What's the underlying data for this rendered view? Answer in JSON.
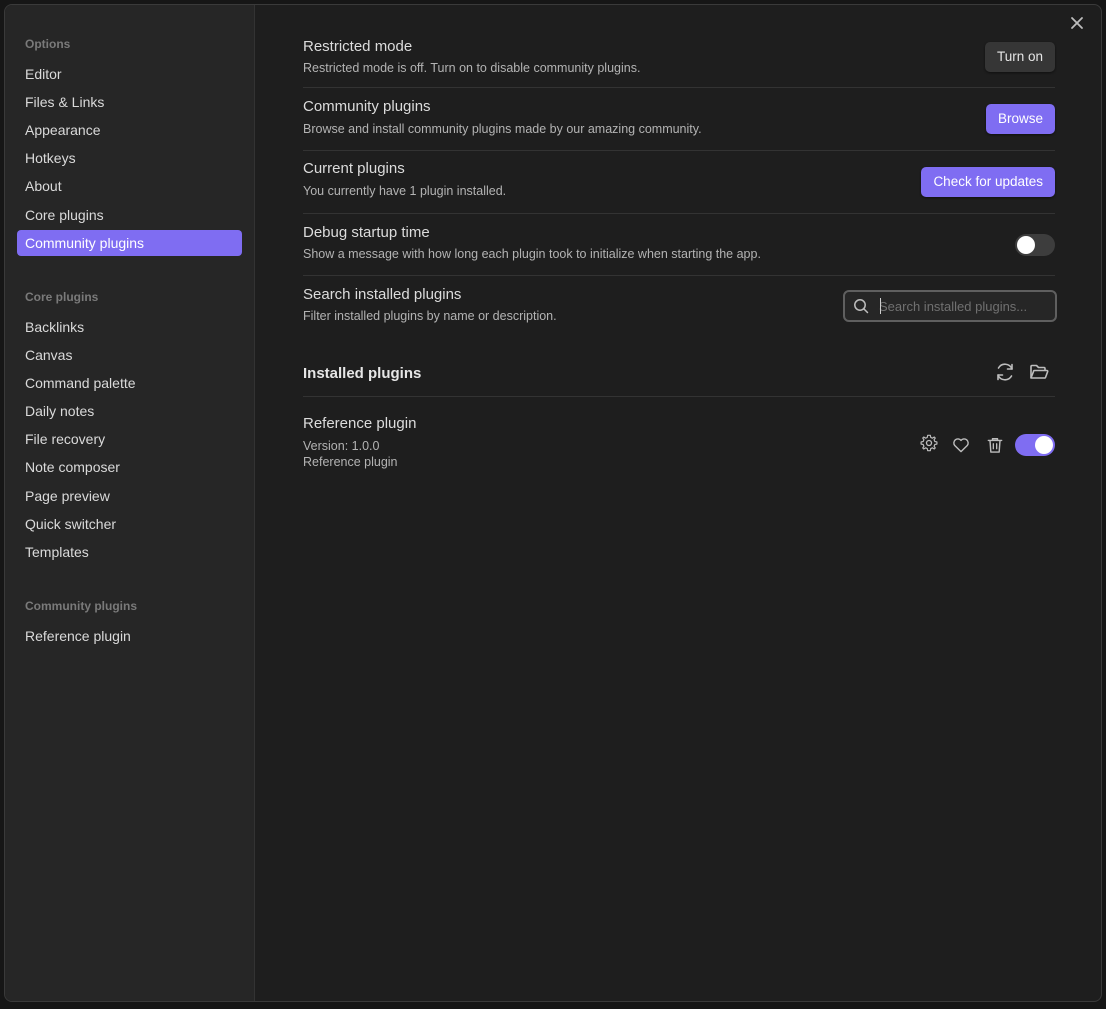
{
  "sidebar": {
    "options_title": "Options",
    "options_items": [
      "Editor",
      "Files & Links",
      "Appearance",
      "Hotkeys",
      "About",
      "Core plugins",
      "Community plugins"
    ],
    "active_item": "Community plugins",
    "core_title": "Core plugins",
    "core_items": [
      "Backlinks",
      "Canvas",
      "Command palette",
      "Daily notes",
      "File recovery",
      "Note composer",
      "Page preview",
      "Quick switcher",
      "Templates"
    ],
    "community_title": "Community plugins",
    "community_items": [
      "Reference plugin"
    ]
  },
  "close_icon": "close-icon",
  "settings": {
    "restricted": {
      "name": "Restricted mode",
      "desc": "Restricted mode is off. Turn on to disable community plugins.",
      "button": "Turn on"
    },
    "community": {
      "name": "Community plugins",
      "desc": "Browse and install community plugins made by our amazing community.",
      "button": "Browse"
    },
    "current": {
      "name": "Current plugins",
      "desc": "You currently have 1 plugin installed.",
      "button": "Check for updates"
    },
    "debug": {
      "name": "Debug startup time",
      "desc": "Show a message with how long each plugin took to initialize when starting the app.",
      "toggle_on": false
    },
    "search": {
      "name": "Search installed plugins",
      "desc": "Filter installed plugins by name or description.",
      "placeholder": "Search installed plugins...",
      "value": ""
    }
  },
  "installed": {
    "heading": "Installed plugins",
    "icons": [
      "refresh-icon",
      "folder-open-icon"
    ],
    "plugins": [
      {
        "name": "Reference plugin",
        "version": "Version: 1.0.0",
        "description": "Reference plugin",
        "enabled": true,
        "icons": [
          "gear-icon",
          "heart-icon",
          "trash-icon"
        ]
      }
    ]
  },
  "colors": {
    "accent": "#7f6df2",
    "background": "#1e1e1e",
    "sidebar": "#262626"
  }
}
